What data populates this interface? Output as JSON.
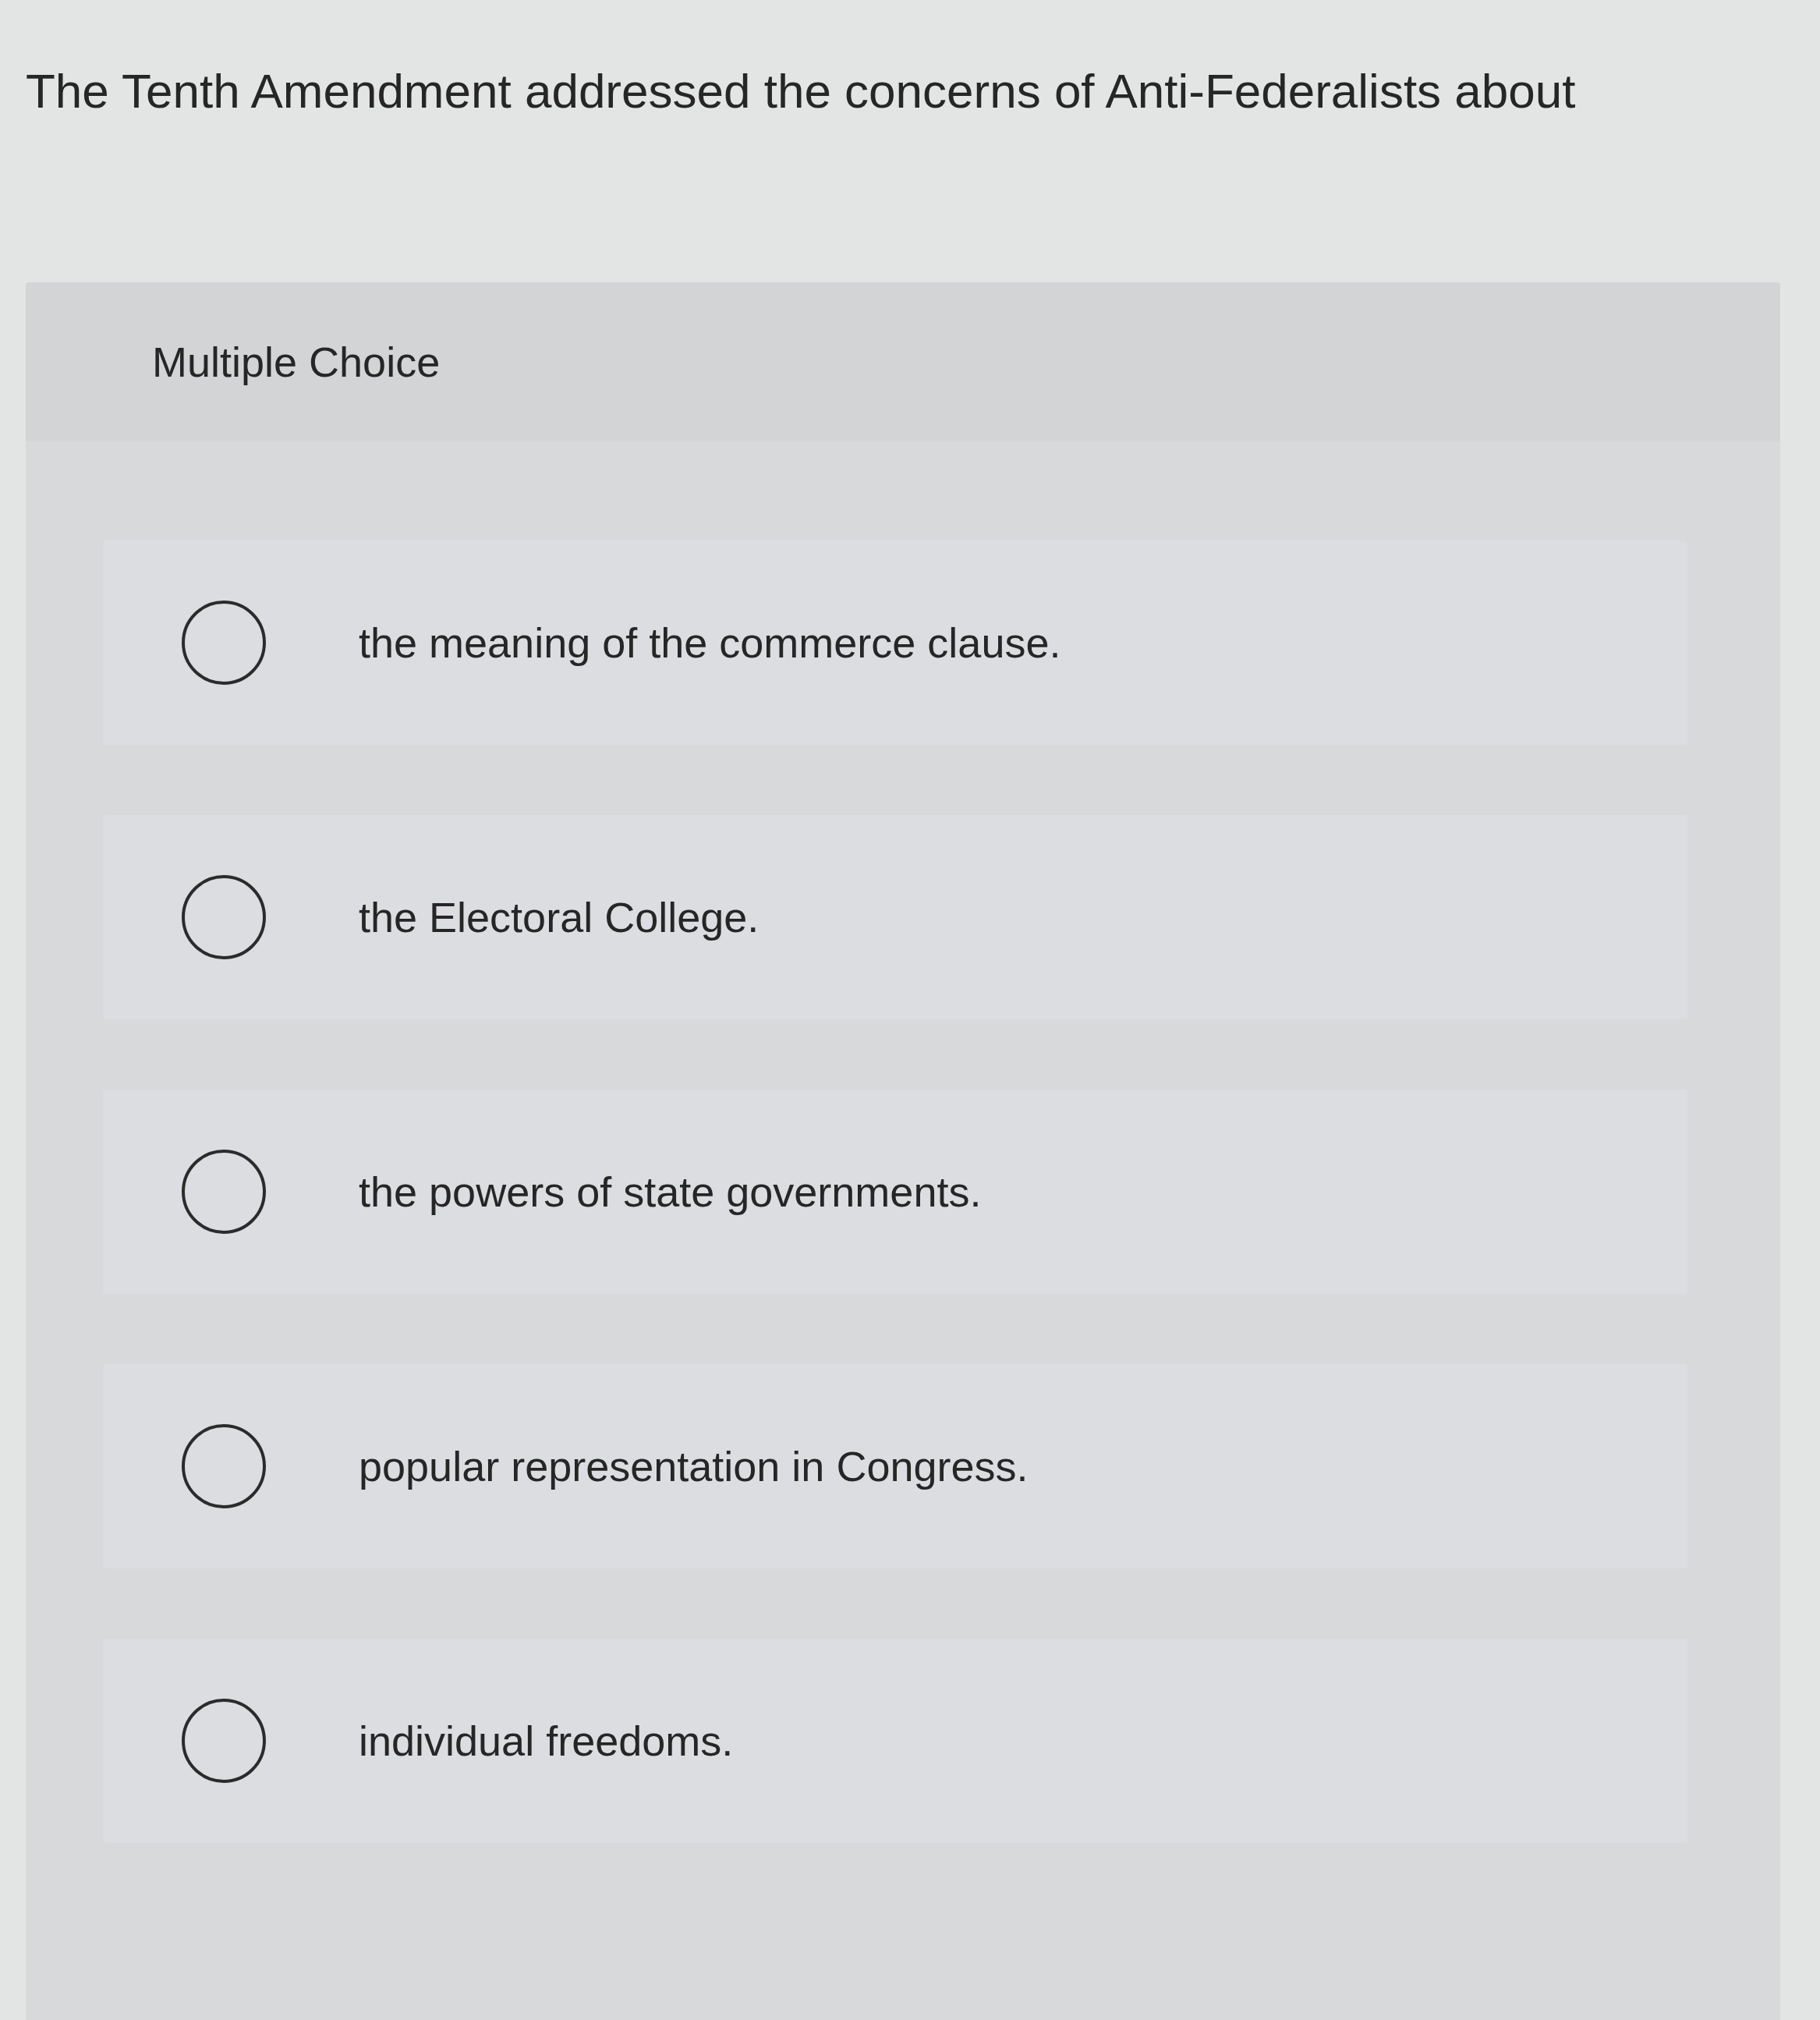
{
  "question": "The Tenth Amendment addressed the concerns of Anti-Federalists about",
  "panel": {
    "type_label": "Multiple Choice",
    "options": [
      {
        "text": "the meaning of the commerce clause.",
        "selected": false
      },
      {
        "text": "the Electoral College.",
        "selected": false
      },
      {
        "text": "the powers of state governments.",
        "selected": false
      },
      {
        "text": "popular representation in Congress.",
        "selected": false
      },
      {
        "text": "individual freedoms.",
        "selected": false
      }
    ]
  }
}
